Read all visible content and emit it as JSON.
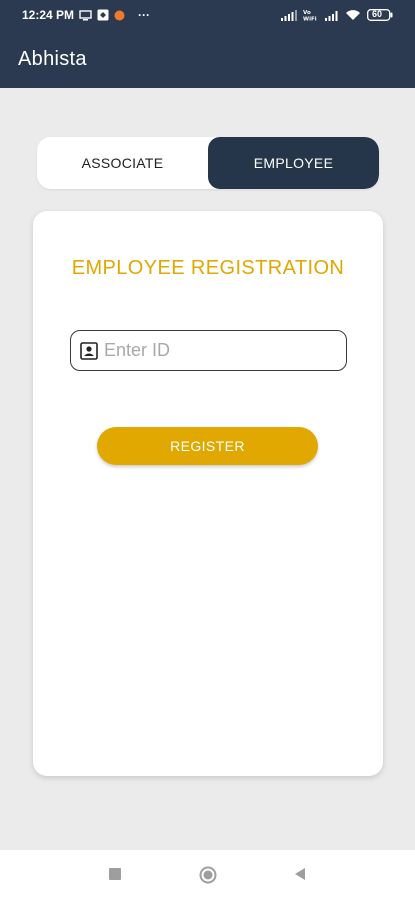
{
  "status_bar": {
    "time": "12:24 PM",
    "battery": "60",
    "more": "···",
    "icons": [
      "screen-icon",
      "app-notification-icon",
      "orange-dot-icon",
      "signal-icon",
      "vowifi-icon",
      "wifi-icon",
      "battery-icon"
    ]
  },
  "app_bar": {
    "title": "Abhista"
  },
  "toggle": {
    "options": [
      {
        "label": "ASSOCIATE",
        "selected": false
      },
      {
        "label": "EMPLOYEE",
        "selected": true
      }
    ]
  },
  "card": {
    "title": "EMPLOYEE REGISTRATION",
    "id_field": {
      "placeholder": "Enter ID",
      "value": ""
    },
    "register_label": "REGISTER"
  },
  "nav_bar": {
    "buttons": [
      "recents-square-icon",
      "home-circle-icon",
      "back-triangle-icon"
    ]
  },
  "colors": {
    "primary": "#2b3a50",
    "accent": "#e0a800",
    "background": "#ebebeb"
  }
}
